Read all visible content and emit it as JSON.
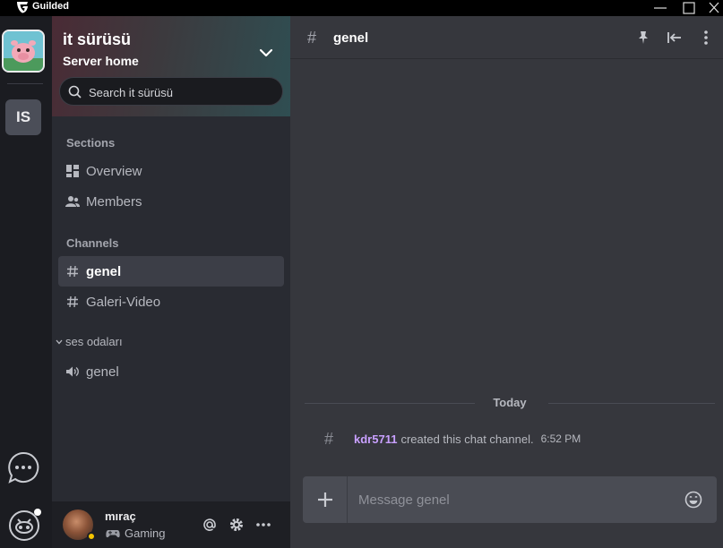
{
  "app": {
    "title": "Guilded"
  },
  "server": {
    "name": "it sürüsü",
    "subtitle": "Server home",
    "rail_initials": "IS"
  },
  "search": {
    "placeholder": "Search it sürüsü"
  },
  "sidebar": {
    "sections_label": "Sections",
    "sections": [
      {
        "label": "Overview",
        "icon": "overview-icon"
      },
      {
        "label": "Members",
        "icon": "members-icon"
      }
    ],
    "channels_label": "Channels",
    "channels": [
      {
        "label": "genel",
        "icon": "hash-icon",
        "active": true
      },
      {
        "label": "Galeri-Video",
        "icon": "hash-icon",
        "active": false
      }
    ],
    "category": {
      "label": "ses odaları",
      "items": [
        {
          "label": "genel",
          "icon": "voice-icon"
        }
      ]
    }
  },
  "user": {
    "name": "mıraç",
    "status": "Gaming",
    "status_color": "#f5c400"
  },
  "channel": {
    "hash": "#",
    "name": "genel"
  },
  "messages": {
    "date_divider": "Today",
    "system": {
      "author": "kdr5711",
      "text": "created this chat channel.",
      "time": "6:52 PM"
    }
  },
  "composer": {
    "placeholder": "Message genel"
  },
  "colors": {
    "accent_author": "#c9a0ff",
    "main_bg": "#36373d",
    "sidebar_bg": "#292b32"
  }
}
